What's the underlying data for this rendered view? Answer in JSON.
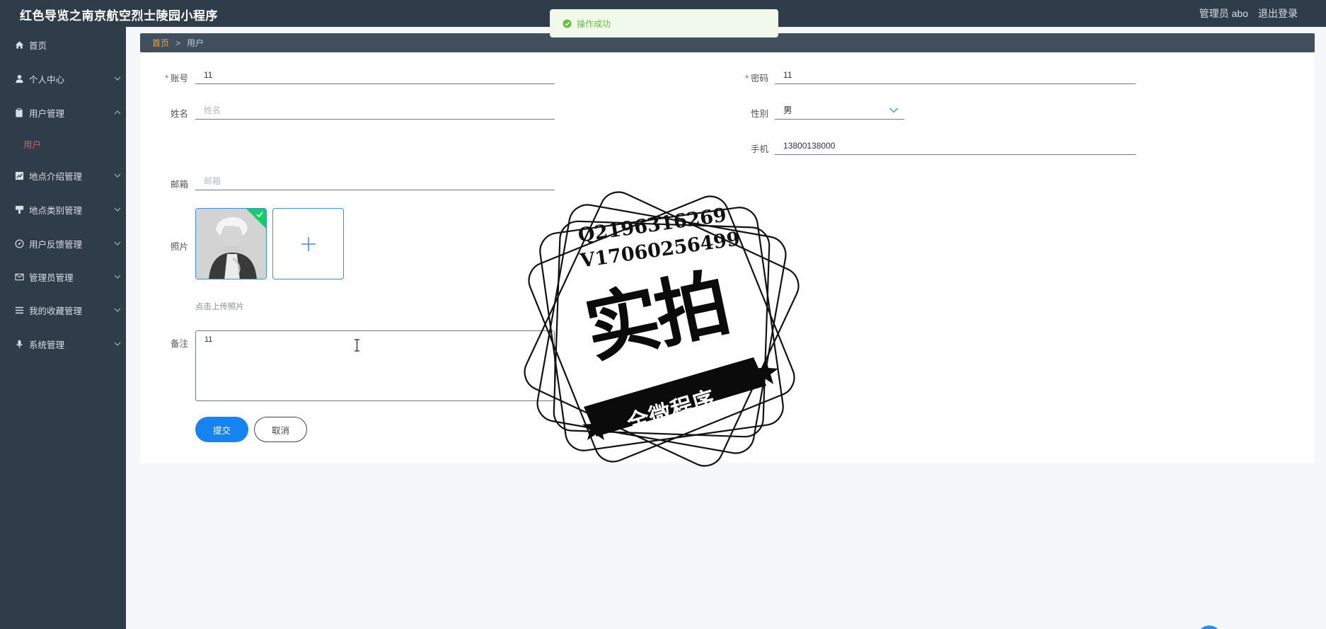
{
  "header": {
    "app_title": "红色导览之南京航空烈士陵园小程序",
    "admin_label": "管理员 abo",
    "logout_label": "退出登录"
  },
  "sidebar": {
    "items": [
      {
        "label": "首页",
        "icon": "home-icon"
      },
      {
        "label": "个人中心",
        "icon": "user-icon"
      },
      {
        "label": "用户管理",
        "icon": "clipboard-icon",
        "expanded": true
      },
      {
        "label": "地点介绍管理",
        "icon": "chart-icon"
      },
      {
        "label": "地点类别管理",
        "icon": "brush-icon"
      },
      {
        "label": "用户反馈管理",
        "icon": "compass-icon"
      },
      {
        "label": "管理员管理",
        "icon": "mail-icon"
      },
      {
        "label": "我的收藏管理",
        "icon": "list-icon"
      },
      {
        "label": "系统管理",
        "icon": "mic-icon"
      }
    ],
    "active_sub": "用户"
  },
  "breadcrumb": {
    "home": "首页",
    "separator": ">",
    "current": "用户"
  },
  "toast": {
    "text": "操作成功",
    "color": "#67c23a"
  },
  "form": {
    "account": {
      "label": "账号",
      "value": "11"
    },
    "password": {
      "label": "密码",
      "value": "11"
    },
    "name": {
      "label": "姓名",
      "value": "",
      "placeholder": "姓名"
    },
    "gender": {
      "label": "性别",
      "value": "男"
    },
    "phone": {
      "label": "手机",
      "value": "13800138000"
    },
    "email": {
      "label": "邮箱",
      "value": "",
      "placeholder": "邮箱"
    },
    "photo": {
      "label": "照片",
      "hint": "点击上传照片"
    },
    "remark": {
      "label": "备注",
      "value": "11"
    },
    "submit_label": "提交",
    "cancel_label": "取消"
  },
  "watermark": {
    "line1": "Q2196316269",
    "line2": "V17060256499",
    "big_text": "实拍",
    "ribbon_text": "全微程序"
  },
  "colors": {
    "sidebar_bg": "#2f3c4a",
    "accent": "#1783f0",
    "active_text": "#e15a54",
    "breadcrumb_home": "#f0a544"
  }
}
